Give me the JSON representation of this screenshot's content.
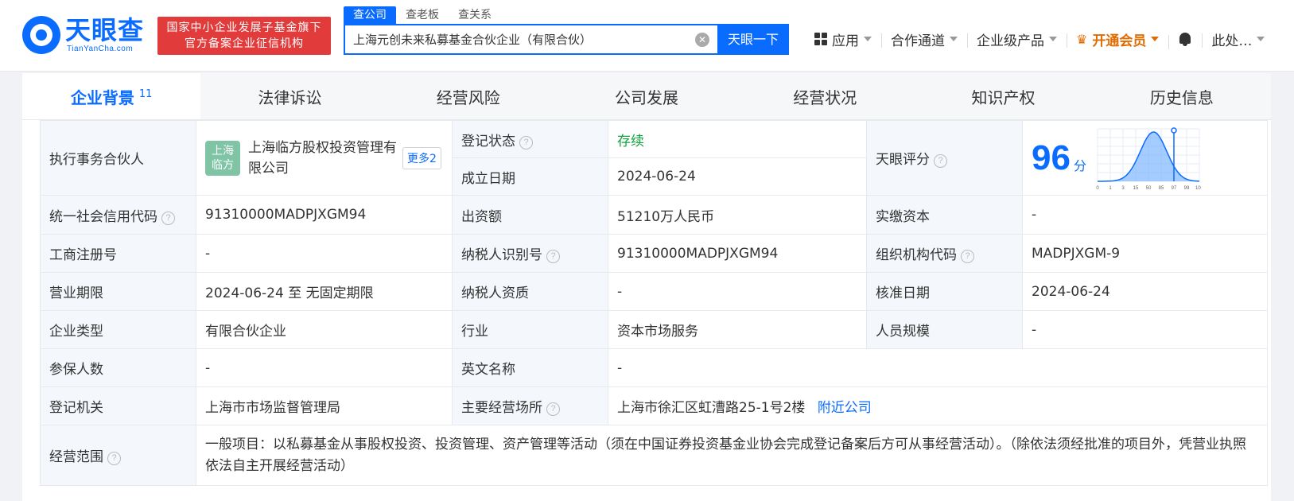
{
  "header": {
    "logo_text": "天眼查",
    "logo_sub": "TianYanCha.com",
    "badge_line1": "国家中小企业发展子基金旗下",
    "badge_line2": "官方备案企业征信机构",
    "search_tabs": [
      "查公司",
      "查老板",
      "查关系"
    ],
    "search_value": "上海元创未来私募基金合伙企业（有限合伙）",
    "search_button": "天眼一下",
    "nav": {
      "apps": "应用",
      "channels": "合作通道",
      "enterprise": "企业级产品",
      "vip": "开通会员",
      "user": "此处…"
    }
  },
  "tabs": [
    {
      "label": "企业背景",
      "count": "11"
    },
    {
      "label": "法律诉讼"
    },
    {
      "label": "经营风险"
    },
    {
      "label": "公司发展"
    },
    {
      "label": "经营状况"
    },
    {
      "label": "知识产权"
    },
    {
      "label": "历史信息"
    }
  ],
  "info": {
    "partner_label": "执行事务合伙人",
    "partner_avatar_line1": "上海",
    "partner_avatar_line2": "临方",
    "partner_name": "上海临方股权投资管理有限公司",
    "partner_more": "更多2",
    "reg_status_label": "登记状态",
    "reg_status": "存续",
    "found_date_label": "成立日期",
    "found_date": "2024-06-24",
    "score_label": "天眼评分",
    "score": "96",
    "score_unit": "分",
    "credit_code_label": "统一社会信用代码",
    "credit_code": "91310000MADPJXGM94",
    "capital_label": "出资额",
    "capital": "51210万人民币",
    "paid_capital_label": "实缴资本",
    "paid_capital": "-",
    "biz_reg_no_label": "工商注册号",
    "biz_reg_no": "-",
    "taxpayer_id_label": "纳税人识别号",
    "taxpayer_id": "91310000MADPJXGM94",
    "org_code_label": "组织机构代码",
    "org_code": "MADPJXGM-9",
    "term_label": "营业期限",
    "term": "2024-06-24 至 无固定期限",
    "taxpayer_qual_label": "纳税人资质",
    "taxpayer_qual": "-",
    "approve_date_label": "核准日期",
    "approve_date": "2024-06-24",
    "type_label": "企业类型",
    "type": "有限合伙企业",
    "industry_label": "行业",
    "industry": "资本市场服务",
    "staff_label": "人员规模",
    "staff": "-",
    "insured_label": "参保人数",
    "insured": "-",
    "en_name_label": "英文名称",
    "en_name": "-",
    "authority_label": "登记机关",
    "authority": "上海市市场监督管理局",
    "address_label": "主要经营场所",
    "address": "上海市徐汇区虹漕路25-1号2楼",
    "nearby": "附近公司",
    "scope_label": "经营范围",
    "scope": "一般项目：以私募基金从事股权投资、投资管理、资产管理等活动（须在中国证券投资基金业协会完成登记备案后方可从事经营活动）。（除依法须经批准的项目外，凭营业执照依法自主开展经营活动）"
  },
  "score_chart": {
    "ticks": [
      "0",
      "1",
      "3",
      "15",
      "50",
      "85",
      "97",
      "99",
      "100"
    ],
    "marker": "97"
  },
  "colors": {
    "brand": "#0a6cff",
    "status_ok": "#12a23f",
    "vip": "#e06b00",
    "badge": "#e23b3b"
  }
}
